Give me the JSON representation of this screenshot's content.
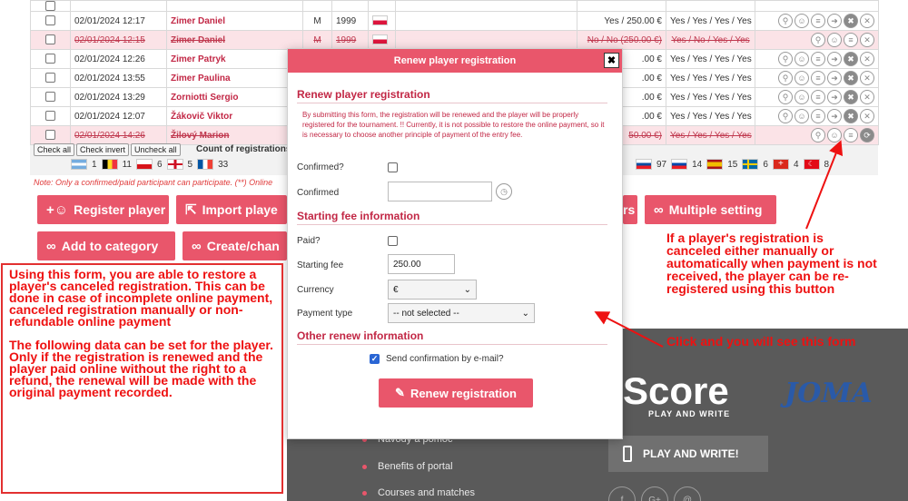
{
  "table": {
    "rows": [
      {
        "date": "",
        "name": "",
        "gender": "",
        "year": "",
        "flag": "",
        "payment": "",
        "consents": "",
        "cancelled": false
      },
      {
        "date": "02/01/2024 12:17",
        "name": "Zimer Daniel",
        "gender": "M",
        "year": "1999",
        "flag": "pl",
        "payment": "Yes / 250.00 €",
        "consents": "Yes / Yes / Yes / Yes",
        "cancelled": false
      },
      {
        "date": "02/01/2024 12:15",
        "name": "Zimer Daniel",
        "gender": "M",
        "year": "1999",
        "flag": "pl",
        "payment": "No / No (250.00 €)",
        "consents": "Yes / No / Yes / Yes",
        "cancelled": true
      },
      {
        "date": "02/01/2024 12:26",
        "name": "Zimer Patryk",
        "gender": "",
        "year": "",
        "flag": "",
        "payment": ".00 €",
        "consents": "Yes / Yes / Yes / Yes",
        "cancelled": false
      },
      {
        "date": "02/01/2024 13:55",
        "name": "Zimer Paulina",
        "gender": "",
        "year": "",
        "flag": "",
        "payment": ".00 €",
        "consents": "Yes / Yes / Yes / Yes",
        "cancelled": false
      },
      {
        "date": "02/01/2024 13:29",
        "name": "Zorniotti Sergio",
        "gender": "",
        "year": "",
        "flag": "",
        "payment": ".00 €",
        "consents": "Yes / Yes / Yes / Yes",
        "cancelled": false
      },
      {
        "date": "02/01/2024 12:07",
        "name": "Žákovič Viktor",
        "gender": "",
        "year": "",
        "flag": "",
        "payment": ".00 €",
        "consents": "Yes / Yes / Yes / Yes",
        "cancelled": false
      },
      {
        "date": "02/01/2024 14:26",
        "name": "Žilový Marion",
        "gender": "",
        "year": "",
        "flag": "",
        "payment": "50.00 €)",
        "consents": "Yes / Yes / Yes / Yes",
        "cancelled": true
      }
    ]
  },
  "controls": {
    "check_all": "Check all",
    "check_invert": "Check invert",
    "uncheck_all": "Uncheck all",
    "count_label": "Count of registrations"
  },
  "flag_counts_left": [
    "1",
    "11",
    "6",
    "5",
    "33"
  ],
  "flag_counts_right": [
    "97",
    "14",
    "15",
    "6",
    "4",
    "8"
  ],
  "note": "Note: Only a confirmed/paid participant can participate. (**) Online",
  "buttons": {
    "register_player": "Register player",
    "import_player": "Import playe",
    "rs_partial": "rs",
    "multiple_setting": "Multiple setting",
    "add_to_category": "Add to category",
    "create_change": "Create/chan"
  },
  "footer": {
    "links": [
      "Návody a pomoc",
      "Benefits of portal",
      "Courses and matches"
    ],
    "score_logo": "Score",
    "score_sub": "PLAY AND WRITE",
    "joma": "JOMA",
    "play_button": "PLAY AND WRITE!",
    "social": [
      "f",
      "G+",
      "@"
    ]
  },
  "modal": {
    "title": "Renew player registration",
    "section_title": "Renew player registration",
    "description": "By submitting this form, the registration will be renewed and the player will be properly registered for the tournament. !! Currently, it is not possible to restore the online payment, so it is necessary to choose another principle of payment of the entry fee.",
    "confirmed_q": "Confirmed?",
    "confirmed": "Confirmed",
    "fee_section": "Starting fee information",
    "paid_q": "Paid?",
    "starting_fee_label": "Starting fee",
    "starting_fee_value": "250.00",
    "currency_label": "Currency",
    "currency_value": "€",
    "payment_type_label": "Payment type",
    "payment_type_value": "-- not selected --",
    "other_section": "Other renew information",
    "send_label": "Send confirmation by e-mail?",
    "submit": "Renew registration"
  },
  "annotations": {
    "left_p1": "Using this form, you are able to restore a player's canceled registration. This can be done in case of incomplete online payment, canceled registration manually or non-refundable online payment",
    "left_p2": "The following data can be set for the player. Only if the registration is renewed and the player paid online without the right to a refund, the renewal will be made with the original payment recorded.",
    "right": "If a player's registration is canceled either manually or automatically when payment is not received, the player can be re-registered using this button",
    "click": "Click and you will see this form"
  },
  "colors": {
    "accent": "#e9566b",
    "annotation": "#ee1111",
    "name_red": "#c22745"
  }
}
